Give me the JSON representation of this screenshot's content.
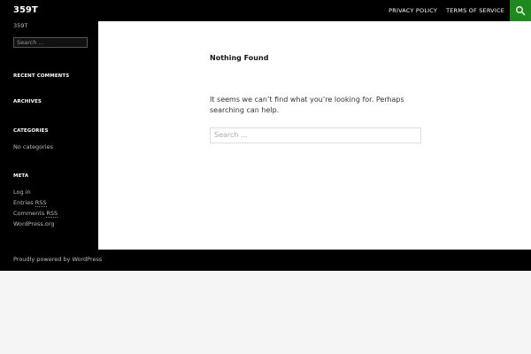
{
  "header": {
    "site_title": "359T",
    "nav": [
      {
        "label": "PRIVACY POLICY"
      },
      {
        "label": "TERMS OF SERVICE"
      }
    ],
    "search_toggle_icon": "search-icon",
    "accent_color": "#1e8a1e"
  },
  "sidebar": {
    "tagline": "359T",
    "search_placeholder": "Search …",
    "recent_comments_title": "RECENT COMMENTS",
    "archives_title": "ARCHIVES",
    "categories_title": "CATEGORIES",
    "categories_empty": "No categories",
    "meta_title": "META",
    "meta_links": {
      "login": "Log in",
      "entries_prefix": "Entries ",
      "comments_prefix": "Comments ",
      "rss": "RSS",
      "wordpress": "WordPress.org"
    }
  },
  "main": {
    "title": "Nothing Found",
    "message": "It seems we can’t find what you’re looking for. Perhaps searching can help.",
    "search_placeholder": "Search …"
  },
  "footer": {
    "credit": "Proudly powered by WordPress"
  }
}
